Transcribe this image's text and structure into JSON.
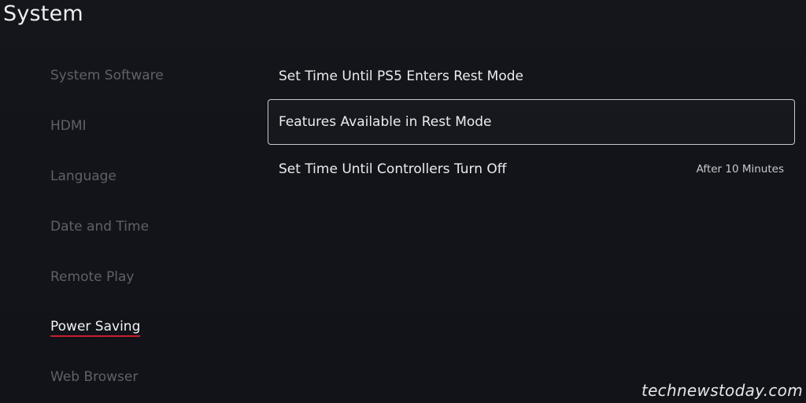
{
  "header": {
    "title": "System"
  },
  "sidebar": {
    "items": [
      {
        "label": "System Software"
      },
      {
        "label": "HDMI"
      },
      {
        "label": "Language"
      },
      {
        "label": "Date and Time"
      },
      {
        "label": "Remote Play"
      },
      {
        "label": "Power Saving"
      },
      {
        "label": "Web Browser"
      }
    ],
    "selected": "Power Saving",
    "accent_color": "#c81e2d"
  },
  "main": {
    "rows": [
      {
        "label": "Set Time Until PS5 Enters Rest Mode",
        "value": ""
      },
      {
        "label": "Features Available in Rest Mode",
        "value": ""
      },
      {
        "label": "Set Time Until Controllers Turn Off",
        "value": "After 10 Minutes"
      }
    ],
    "focused_row": "Features Available in Rest Mode"
  },
  "watermark": {
    "text": "technewstoday.com"
  }
}
